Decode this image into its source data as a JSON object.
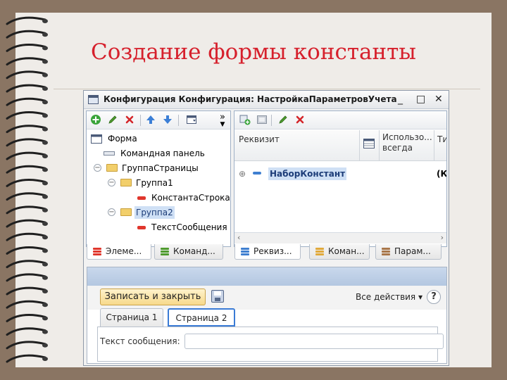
{
  "slide": {
    "title": "Создание формы константы"
  },
  "window": {
    "title": "Конфигурация Конфигурация: НастройкаПараметровУчета",
    "controls": {
      "minimize": "_",
      "maximize": "□",
      "close": "✕"
    }
  },
  "toolbar_left": {
    "icons": [
      "add-icon",
      "edit-pencil-icon",
      "delete-icon",
      "move-up-icon",
      "move-down-icon",
      "form-layout-icon"
    ],
    "more": "»"
  },
  "elements_tree": [
    {
      "label": "Форма"
    },
    {
      "label": "Командная панель"
    },
    {
      "label": "ГруппаСтраницы"
    },
    {
      "label": "Группа1"
    },
    {
      "label": "КонстантаСтрока"
    },
    {
      "label": "Группа2",
      "selected": true
    },
    {
      "label": "ТекстСообщения"
    }
  ],
  "left_tabs": [
    {
      "label": "Элеме...",
      "active": true
    },
    {
      "label": "Команд..."
    }
  ],
  "toolbar_right": {
    "icons": [
      "add-attribute-icon",
      "data-icon",
      "edit-pencil-icon",
      "delete-icon"
    ]
  },
  "attributes_grid": {
    "columns": [
      {
        "label": "Реквизит"
      },
      {
        "label": "Использо...\nвсегда"
      },
      {
        "label": "Ти"
      }
    ],
    "rows": [
      {
        "name": "НаборКонстант",
        "type": "(Ко"
      }
    ]
  },
  "right_tabs": [
    {
      "label": "Реквиз...",
      "active": true
    },
    {
      "label": "Коман..."
    },
    {
      "label": "Парам..."
    }
  ],
  "form_preview": {
    "save_button": "Записать и закрыть",
    "all_actions": "Все действия ▾",
    "help": "?",
    "tabs": [
      {
        "label": "Страница 1"
      },
      {
        "label": "Страница 2",
        "active": true
      }
    ],
    "field_label": "Текст сообщения:",
    "field_value": ""
  },
  "colors": {
    "title_red": "#d6202c",
    "selection": "#cfe0f5",
    "active_tab_border": "#3a7bd5",
    "save_button": "#f7d98b"
  }
}
